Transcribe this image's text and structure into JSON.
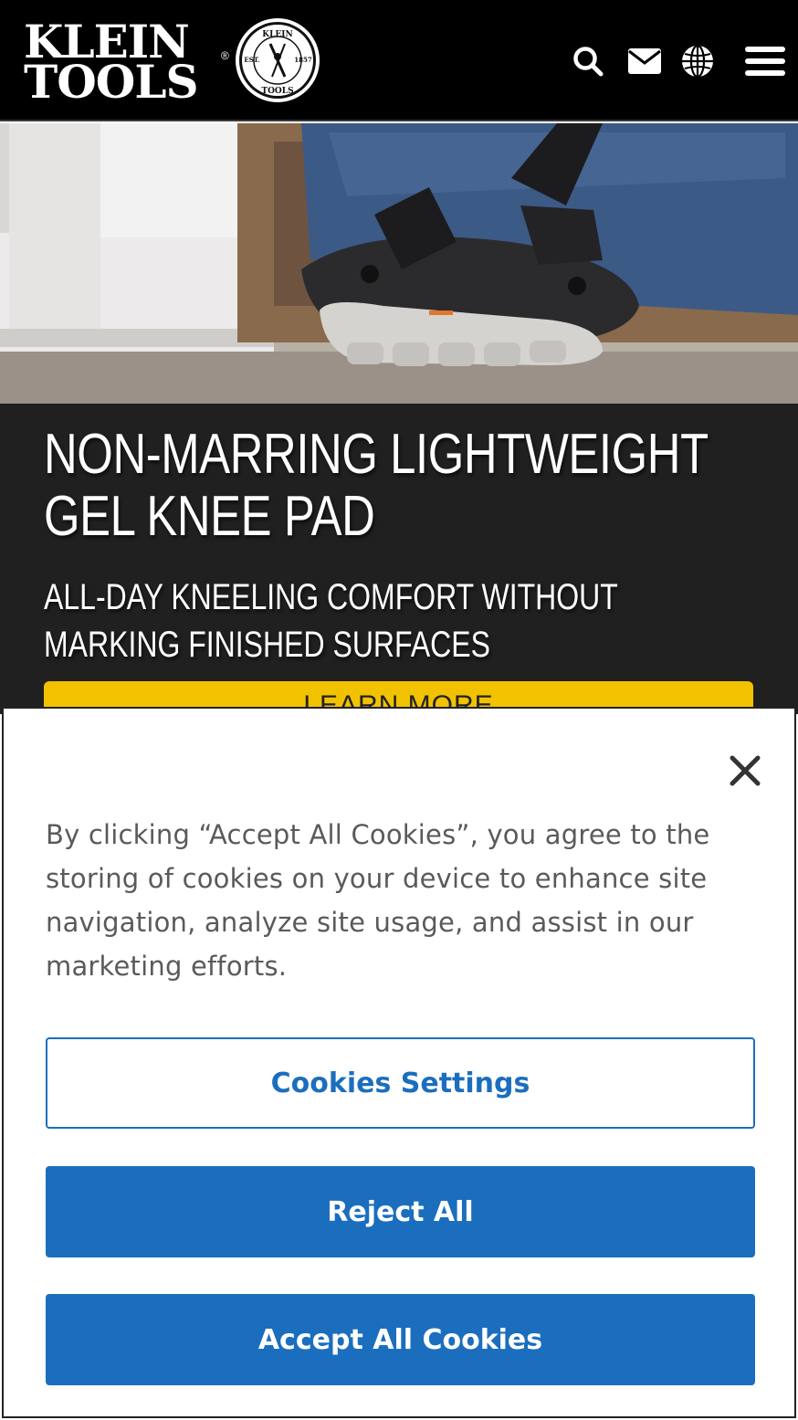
{
  "header": {
    "logo_line1": "KLEIN",
    "logo_line2": "TOOLS",
    "logo_registered": "®",
    "seal_top": "KLEIN",
    "seal_left": "EST.",
    "seal_right": "1857",
    "seal_bottom": "TOOLS",
    "icons": [
      "search-icon",
      "envelope-icon",
      "globe-icon",
      "hamburger-menu-icon"
    ]
  },
  "promo": {
    "title": "NON-MARRING LIGHTWEIGHT GEL KNEE PAD",
    "subtitle": "ALL-DAY KNEELING COMFORT WITHOUT MARKING FINISHED SURFACES",
    "cta_label": "LEARN MORE",
    "cta_color": "#f2c200"
  },
  "cookie_banner": {
    "close_icon": "close-icon",
    "message": "By clicking “Accept All Cookies”, you agree to the storing of cookies on your device to enhance site navigation, analyze site usage, and assist in our marketing efforts.",
    "settings_label": "Cookies Settings",
    "reject_label": "Reject All",
    "accept_label": "Accept All Cookies",
    "accent_color": "#1b6ebe"
  }
}
